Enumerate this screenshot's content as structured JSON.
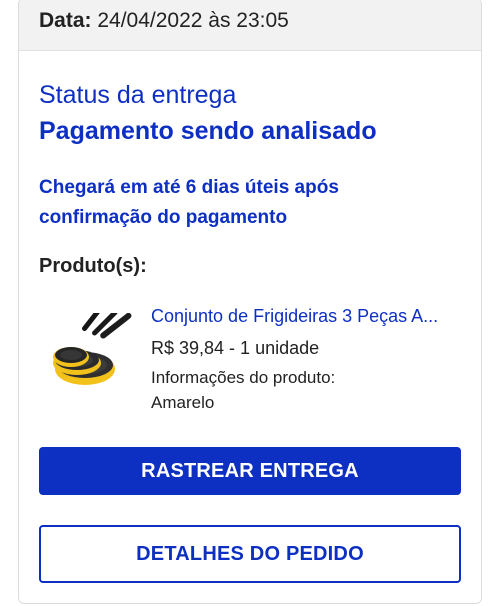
{
  "order": {
    "date_label": "Data:",
    "date_value": "24/04/2022 às 23:05"
  },
  "delivery": {
    "status_title": "Status da entrega",
    "status_value": "Pagamento sendo analisado",
    "note": "Chegará em até 6 dias úteis após confirmação do pagamento"
  },
  "products": {
    "label": "Produto(s):",
    "items": [
      {
        "name": "Conjunto de Frigideiras 3 Peças A...",
        "price_qty": "R$ 39,84 - 1 unidade",
        "info_label": "Informações do produto:",
        "info_value": "Amarelo",
        "image_icon": "frying-pans-image"
      }
    ]
  },
  "actions": {
    "track_label": "RASTREAR ENTREGA",
    "details_label": "DETALHES DO PEDIDO"
  },
  "colors": {
    "accent": "#0d2fc2",
    "header_bg": "#f2f2f2",
    "pan_yellow": "#f2c21b"
  }
}
